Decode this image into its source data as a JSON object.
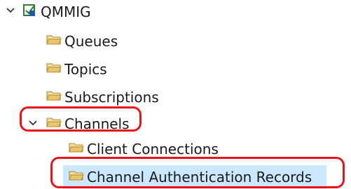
{
  "tree": {
    "root": {
      "label": "QMMIG",
      "expanded": true,
      "icon": "queue-manager-icon"
    },
    "children": [
      {
        "label": "Queues",
        "icon": "folder-open-icon"
      },
      {
        "label": "Topics",
        "icon": "folder-open-icon"
      },
      {
        "label": "Subscriptions",
        "icon": "folder-open-icon"
      },
      {
        "label": "Channels",
        "expanded": true,
        "icon": "folder-open-icon",
        "children": [
          {
            "label": "Client Connections",
            "icon": "folder-open-icon"
          },
          {
            "label": "Channel Authentication Records",
            "icon": "folder-open-icon",
            "selected": true
          }
        ]
      }
    ]
  },
  "colors": {
    "folder": "#c9a24a",
    "selection": "#cce8ff",
    "annotation": "#e8141b",
    "qmgr_icon": "#2e7d32"
  }
}
